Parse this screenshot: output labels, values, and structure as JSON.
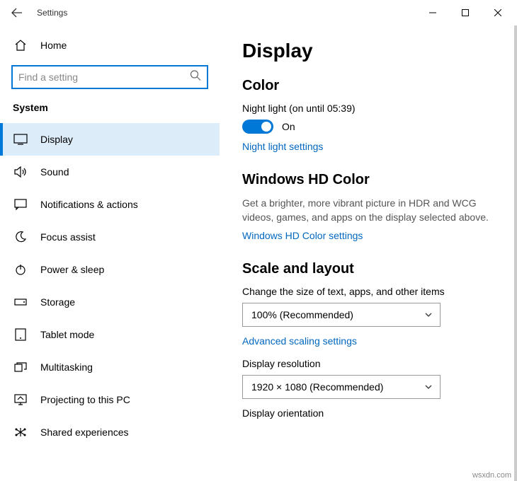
{
  "titlebar": {
    "title": "Settings"
  },
  "sidebar": {
    "home": "Home",
    "search_placeholder": "Find a setting",
    "category": "System",
    "items": [
      {
        "label": "Display"
      },
      {
        "label": "Sound"
      },
      {
        "label": "Notifications & actions"
      },
      {
        "label": "Focus assist"
      },
      {
        "label": "Power & sleep"
      },
      {
        "label": "Storage"
      },
      {
        "label": "Tablet mode"
      },
      {
        "label": "Multitasking"
      },
      {
        "label": "Projecting to this PC"
      },
      {
        "label": "Shared experiences"
      }
    ]
  },
  "content": {
    "page_title": "Display",
    "color": {
      "heading": "Color",
      "night_light_status": "Night light (on until 05:39)",
      "toggle_label": "On",
      "link": "Night light settings"
    },
    "hd": {
      "heading": "Windows HD Color",
      "desc": "Get a brighter, more vibrant picture in HDR and WCG videos, games, and apps on the display selected above.",
      "link": "Windows HD Color settings"
    },
    "scale": {
      "heading": "Scale and layout",
      "size_label": "Change the size of text, apps, and other items",
      "size_value": "100% (Recommended)",
      "advanced_link": "Advanced scaling settings",
      "resolution_label": "Display resolution",
      "resolution_value": "1920 × 1080 (Recommended)",
      "orientation_label": "Display orientation"
    }
  },
  "watermark": "wsxdn.com"
}
